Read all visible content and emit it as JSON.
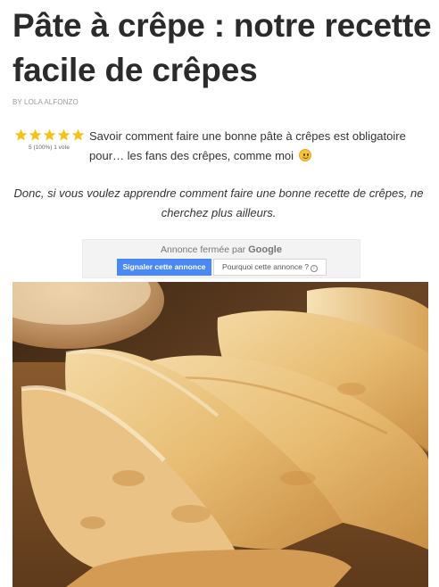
{
  "article": {
    "title": "Pâte à crêpe : notre recette facile de crêpes",
    "byline": "BY LOLA ALFONZO"
  },
  "rating": {
    "stars": 5,
    "max_stars": 5,
    "vote_text": "5 (100%) 1 vote",
    "star_color": "#f2c31b"
  },
  "intro": {
    "text": "Savoir comment faire une bonne pâte à crêpes est obligatoire pour… les fans des crêpes, comme moi",
    "emoji": "smiley-icon"
  },
  "quote": {
    "text": "Donc, si vous voulez apprendre comment faire une bonne recette de crêpes, ne cherchez plus ailleurs."
  },
  "ad": {
    "closed_text": "Annonce fermée par",
    "brand": "Google",
    "report_label": "Signaler cette annonce",
    "why_label": "Pourquoi cette annonce ?",
    "report_color": "#4a89f3"
  },
  "hero_image": {
    "subject": "stack of folded golden crêpes on a wooden board"
  }
}
